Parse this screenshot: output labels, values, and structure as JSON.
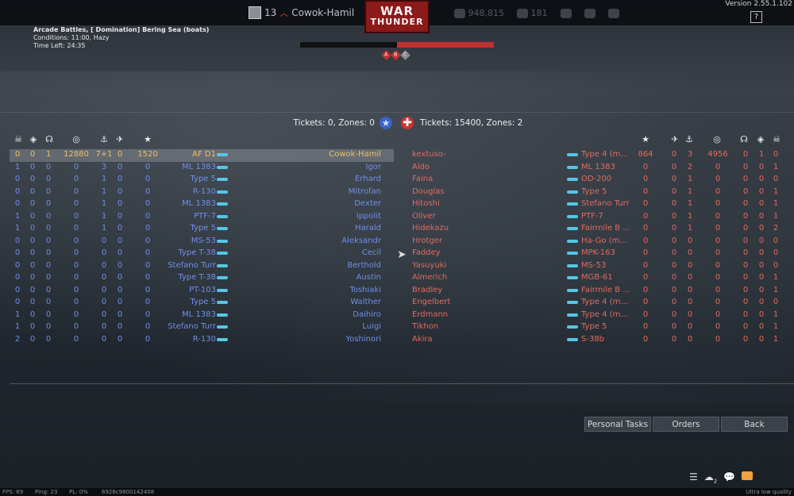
{
  "topbar": {
    "player_rank": "13",
    "player_name": "Cowok-Hamil",
    "logo_line1": "WAR",
    "logo_line2": "THUNDER",
    "currencies": [
      "948,815",
      "181"
    ],
    "version": "Version 2.55.1.102",
    "help_label": "?"
  },
  "mission": {
    "title": "Arcade Battles, [ Domination] Bering Sea (boats)",
    "conditions": "Conditions: 11:00, Hazy",
    "time_left": "Time Left: 24:35"
  },
  "progress": {
    "enemy_fraction": 0.5
  },
  "zones": [
    {
      "label": "A",
      "owner": "enemy"
    },
    {
      "label": "B",
      "owner": "enemy"
    },
    {
      "label": "C",
      "owner": "neutral"
    }
  ],
  "tickets": {
    "ally": "Tickets: 0, Zones: 0",
    "enemy": "Tickets: 15400, Zones: 2"
  },
  "colors": {
    "ally": "#6f8fe8",
    "enemy": "#e06b60",
    "highlight": "#e8c06a",
    "ship": "#55c7e6"
  },
  "header_icons": [
    "skull-icon",
    "assists-icon",
    "captures-icon",
    "score-ring-icon",
    "naval-kills-icon",
    "air-kills-icon",
    "star-icon"
  ],
  "ally_rows": [
    {
      "c1": "0",
      "c2": "0",
      "c3": "1",
      "score": "12880",
      "naval": "7+1",
      "air": "0",
      "pts": "1520",
      "vehicle": "AF D1",
      "name": "Cowok-Hamil",
      "highlight": true
    },
    {
      "c1": "1",
      "c2": "0",
      "c3": "0",
      "score": "0",
      "naval": "3",
      "air": "0",
      "pts": "0",
      "vehicle": "ML 1383",
      "name": "Igor"
    },
    {
      "c1": "0",
      "c2": "0",
      "c3": "0",
      "score": "0",
      "naval": "1",
      "air": "0",
      "pts": "0",
      "vehicle": "Type 5",
      "name": "Erhard"
    },
    {
      "c1": "0",
      "c2": "0",
      "c3": "0",
      "score": "0",
      "naval": "1",
      "air": "0",
      "pts": "0",
      "vehicle": "R-130",
      "name": "Mitrofan"
    },
    {
      "c1": "0",
      "c2": "0",
      "c3": "0",
      "score": "0",
      "naval": "1",
      "air": "0",
      "pts": "0",
      "vehicle": "ML 1383",
      "name": "Dexter"
    },
    {
      "c1": "1",
      "c2": "0",
      "c3": "0",
      "score": "0",
      "naval": "1",
      "air": "0",
      "pts": "0",
      "vehicle": "PTF-7",
      "name": "Ippolit"
    },
    {
      "c1": "1",
      "c2": "0",
      "c3": "0",
      "score": "0",
      "naval": "1",
      "air": "0",
      "pts": "0",
      "vehicle": "Type 5",
      "name": "Harald"
    },
    {
      "c1": "0",
      "c2": "0",
      "c3": "0",
      "score": "0",
      "naval": "0",
      "air": "0",
      "pts": "0",
      "vehicle": "MS-53",
      "name": "Aleksandr"
    },
    {
      "c1": "0",
      "c2": "0",
      "c3": "0",
      "score": "0",
      "naval": "0",
      "air": "0",
      "pts": "0",
      "vehicle": "Type T-38",
      "name": "Cecil"
    },
    {
      "c1": "0",
      "c2": "0",
      "c3": "0",
      "score": "0",
      "naval": "0",
      "air": "0",
      "pts": "0",
      "vehicle": "Stefano Turr",
      "name": "Berthold"
    },
    {
      "c1": "0",
      "c2": "0",
      "c3": "0",
      "score": "0",
      "naval": "0",
      "air": "0",
      "pts": "0",
      "vehicle": "Type T-38",
      "name": "Austin"
    },
    {
      "c1": "0",
      "c2": "0",
      "c3": "0",
      "score": "0",
      "naval": "0",
      "air": "0",
      "pts": "0",
      "vehicle": "PT-103",
      "name": "Toshiaki"
    },
    {
      "c1": "0",
      "c2": "0",
      "c3": "0",
      "score": "0",
      "naval": "0",
      "air": "0",
      "pts": "0",
      "vehicle": "Type 5",
      "name": "Walther"
    },
    {
      "c1": "1",
      "c2": "0",
      "c3": "0",
      "score": "0",
      "naval": "0",
      "air": "0",
      "pts": "0",
      "vehicle": "ML 1383",
      "name": "Daihiro"
    },
    {
      "c1": "1",
      "c2": "0",
      "c3": "0",
      "score": "0",
      "naval": "0",
      "air": "0",
      "pts": "0",
      "vehicle": "Stefano Turr",
      "name": "Luigi"
    },
    {
      "c1": "2",
      "c2": "0",
      "c3": "0",
      "score": "0",
      "naval": "0",
      "air": "0",
      "pts": "0",
      "vehicle": "R-130",
      "name": "Yoshinori"
    }
  ],
  "enemy_rows": [
    {
      "name": "kextuso-",
      "vehicle": "Type 4 (m...",
      "pts": "864",
      "air": "0",
      "naval": "3",
      "score": "4956",
      "c3": "0",
      "c2": "1",
      "c1": "0"
    },
    {
      "name": "Aldo",
      "vehicle": "ML 1383",
      "pts": "0",
      "air": "0",
      "naval": "2",
      "score": "0",
      "c3": "0",
      "c2": "0",
      "c1": "1"
    },
    {
      "name": "Faina",
      "vehicle": "OD-200",
      "pts": "0",
      "air": "0",
      "naval": "1",
      "score": "0",
      "c3": "0",
      "c2": "0",
      "c1": "0"
    },
    {
      "name": "Douglas",
      "vehicle": "Type 5",
      "pts": "0",
      "air": "0",
      "naval": "1",
      "score": "0",
      "c3": "0",
      "c2": "0",
      "c1": "1"
    },
    {
      "name": "Hitoshi",
      "vehicle": "Stefano Turr",
      "pts": "0",
      "air": "0",
      "naval": "1",
      "score": "0",
      "c3": "0",
      "c2": "0",
      "c1": "1"
    },
    {
      "name": "Oliver",
      "vehicle": "PTF-7",
      "pts": "0",
      "air": "0",
      "naval": "1",
      "score": "0",
      "c3": "0",
      "c2": "0",
      "c1": "1"
    },
    {
      "name": "Hidekazu",
      "vehicle": "Fairmile B ...",
      "pts": "0",
      "air": "0",
      "naval": "1",
      "score": "0",
      "c3": "0",
      "c2": "0",
      "c1": "2"
    },
    {
      "name": "Hrotger",
      "vehicle": "Ha-Go (m...",
      "pts": "0",
      "air": "0",
      "naval": "0",
      "score": "0",
      "c3": "0",
      "c2": "0",
      "c1": "0"
    },
    {
      "name": "Faddey",
      "vehicle": "MPK-163",
      "pts": "0",
      "air": "0",
      "naval": "0",
      "score": "0",
      "c3": "0",
      "c2": "0",
      "c1": "0"
    },
    {
      "name": "Yasuyuki",
      "vehicle": "MS-53",
      "pts": "0",
      "air": "0",
      "naval": "0",
      "score": "0",
      "c3": "0",
      "c2": "0",
      "c1": "0"
    },
    {
      "name": "Almerich",
      "vehicle": "MGB-61",
      "pts": "0",
      "air": "0",
      "naval": "0",
      "score": "0",
      "c3": "0",
      "c2": "0",
      "c1": "1"
    },
    {
      "name": "Bradley",
      "vehicle": "Fairmile B ...",
      "pts": "0",
      "air": "0",
      "naval": "0",
      "score": "0",
      "c3": "0",
      "c2": "0",
      "c1": "1"
    },
    {
      "name": "Engelbert",
      "vehicle": "Type 4 (m...",
      "pts": "0",
      "air": "0",
      "naval": "0",
      "score": "0",
      "c3": "0",
      "c2": "0",
      "c1": "0"
    },
    {
      "name": "Erdmann",
      "vehicle": "Type 4 (m...",
      "pts": "0",
      "air": "0",
      "naval": "0",
      "score": "0",
      "c3": "0",
      "c2": "0",
      "c1": "1"
    },
    {
      "name": "Tikhon",
      "vehicle": "Type 5",
      "pts": "0",
      "air": "0",
      "naval": "0",
      "score": "0",
      "c3": "0",
      "c2": "0",
      "c1": "1"
    },
    {
      "name": "Akira",
      "vehicle": "S-38b",
      "pts": "0",
      "air": "0",
      "naval": "0",
      "score": "0",
      "c3": "0",
      "c2": "0",
      "c1": "1"
    }
  ],
  "buttons": {
    "personal_tasks": "Personal Tasks",
    "orders": "Orders",
    "back": "Back"
  },
  "status": {
    "fps": "FPS: 69",
    "ping": "Ping: 23",
    "pl": "PL: 0%",
    "session": "6926c9800142408",
    "quality": "Ultra low quality",
    "squad_count": "2"
  }
}
